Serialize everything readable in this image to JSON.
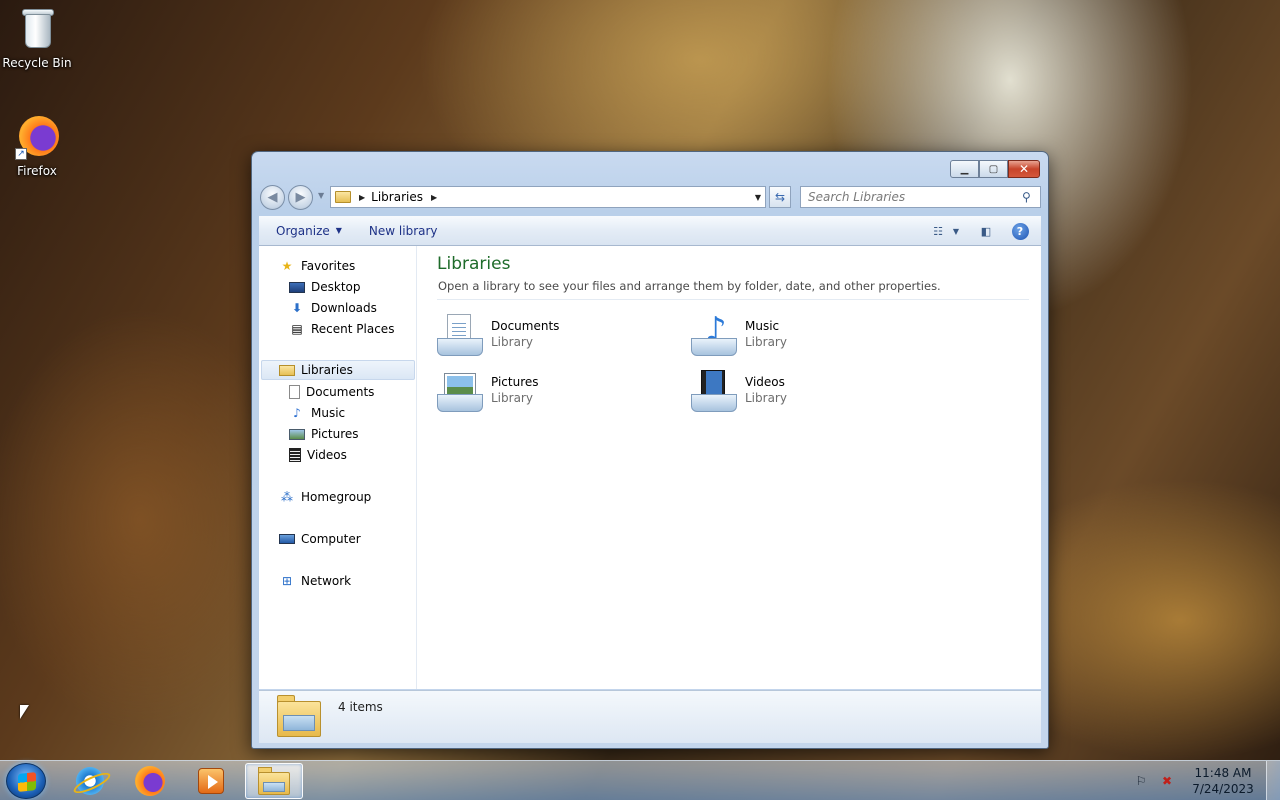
{
  "desktop": {
    "icons": [
      {
        "label": "Recycle Bin",
        "icon": "recycle-bin-icon"
      },
      {
        "label": "Firefox",
        "icon": "firefox-icon"
      }
    ]
  },
  "window": {
    "address": {
      "crumb": "Libraries"
    },
    "search": {
      "placeholder": "Search Libraries"
    },
    "toolbar": {
      "organize": "Organize",
      "new_library": "New library"
    },
    "nav": {
      "favorites": "Favorites",
      "desktop": "Desktop",
      "downloads": "Downloads",
      "recent": "Recent Places",
      "libraries": "Libraries",
      "documents": "Documents",
      "music": "Music",
      "pictures": "Pictures",
      "videos": "Videos",
      "homegroup": "Homegroup",
      "computer": "Computer",
      "network": "Network"
    },
    "main": {
      "title": "Libraries",
      "subtitle": "Open a library to see your files and arrange them by folder, date, and other properties.",
      "items": [
        {
          "name": "Documents",
          "kind": "Library",
          "icon": "documents-library-icon"
        },
        {
          "name": "Music",
          "kind": "Library",
          "icon": "music-library-icon"
        },
        {
          "name": "Pictures",
          "kind": "Library",
          "icon": "pictures-library-icon"
        },
        {
          "name": "Videos",
          "kind": "Library",
          "icon": "videos-library-icon"
        }
      ]
    },
    "details": {
      "count": "4 items"
    }
  },
  "taskbar": {
    "apps": [
      "internet-explorer-icon",
      "firefox-icon",
      "media-player-icon",
      "windows-explorer-icon"
    ],
    "clock": {
      "time": "11:48 AM",
      "date": "7/24/2023"
    }
  },
  "colors": {
    "title_green": "#1e6b2a",
    "link_blue": "#1e3287"
  }
}
